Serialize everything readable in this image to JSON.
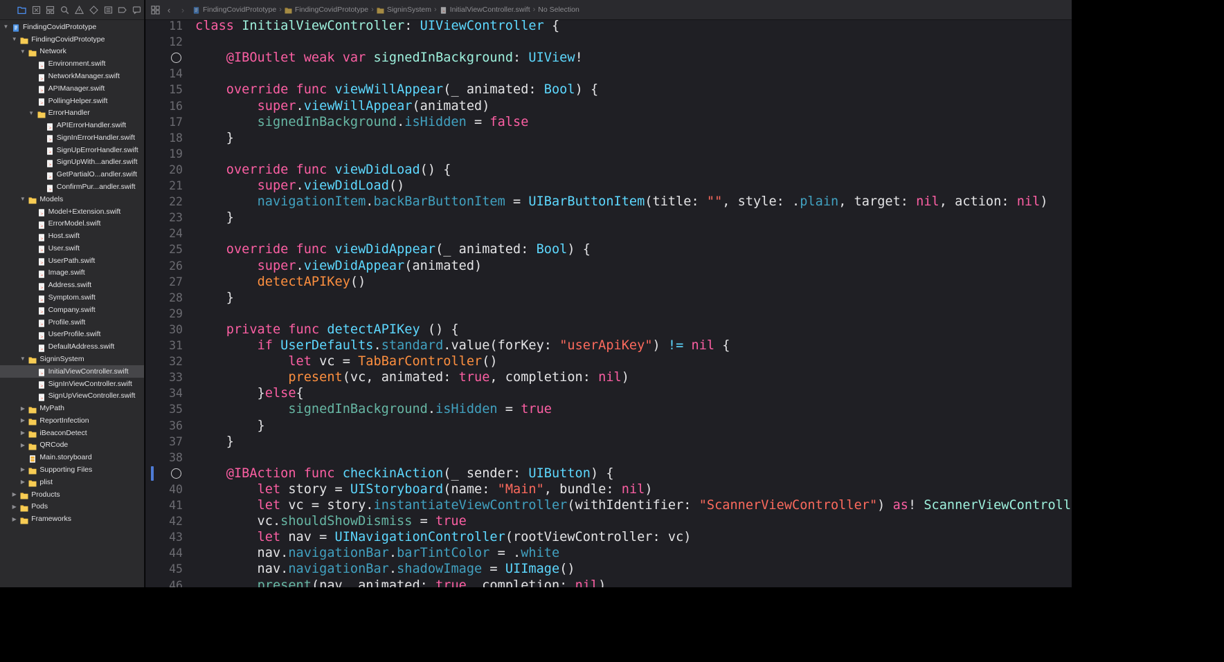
{
  "navigator": {
    "toolbar_icons": [
      "folder-icon",
      "source-control-icon",
      "symbol-icon",
      "find-icon",
      "issue-icon",
      "test-icon",
      "debug-icon",
      "breakpoint-icon",
      "report-icon"
    ],
    "items": [
      {
        "label": "FindingCovidPrototype",
        "depth": 0,
        "kind": "project",
        "disclosure": "open"
      },
      {
        "label": "FindingCovidPrototype",
        "depth": 1,
        "kind": "folder",
        "disclosure": "open"
      },
      {
        "label": "Network",
        "depth": 2,
        "kind": "folder",
        "disclosure": "open"
      },
      {
        "label": "Environment.swift",
        "depth": 3,
        "kind": "swift"
      },
      {
        "label": "NetworkManager.swift",
        "depth": 3,
        "kind": "swift"
      },
      {
        "label": "APIManager.swift",
        "depth": 3,
        "kind": "swift"
      },
      {
        "label": "PollingHelper.swift",
        "depth": 3,
        "kind": "swift"
      },
      {
        "label": "ErrorHandler",
        "depth": 3,
        "kind": "folder",
        "disclosure": "open"
      },
      {
        "label": "APIErrorHandler.swift",
        "depth": 4,
        "kind": "swift"
      },
      {
        "label": "SignInErrorHandler.swift",
        "depth": 4,
        "kind": "swift"
      },
      {
        "label": "SignUpErrorHandler.swift",
        "depth": 4,
        "kind": "swift"
      },
      {
        "label": "SignUpWith...andler.swift",
        "depth": 4,
        "kind": "swift"
      },
      {
        "label": "GetPartialO...andler.swift",
        "depth": 4,
        "kind": "swift"
      },
      {
        "label": "ConfirmPur...andler.swift",
        "depth": 4,
        "kind": "swift"
      },
      {
        "label": "Models",
        "depth": 2,
        "kind": "folder",
        "disclosure": "open"
      },
      {
        "label": "Model+Extension.swift",
        "depth": 3,
        "kind": "swift"
      },
      {
        "label": "ErrorModel.swift",
        "depth": 3,
        "kind": "swift"
      },
      {
        "label": "Host.swift",
        "depth": 3,
        "kind": "swift"
      },
      {
        "label": "User.swift",
        "depth": 3,
        "kind": "swift"
      },
      {
        "label": "UserPath.swift",
        "depth": 3,
        "kind": "swift"
      },
      {
        "label": "Image.swift",
        "depth": 3,
        "kind": "swift"
      },
      {
        "label": "Address.swift",
        "depth": 3,
        "kind": "swift"
      },
      {
        "label": "Symptom.swift",
        "depth": 3,
        "kind": "swift"
      },
      {
        "label": "Company.swift",
        "depth": 3,
        "kind": "swift"
      },
      {
        "label": "Profile.swift",
        "depth": 3,
        "kind": "swift"
      },
      {
        "label": "UserProfile.swift",
        "depth": 3,
        "kind": "swift"
      },
      {
        "label": "DefaultAddress.swift",
        "depth": 3,
        "kind": "swift"
      },
      {
        "label": "SigninSystem",
        "depth": 2,
        "kind": "folder",
        "disclosure": "open"
      },
      {
        "label": "InitialViewController.swift",
        "depth": 3,
        "kind": "swift",
        "selected": true
      },
      {
        "label": "SignInViewController.swift",
        "depth": 3,
        "kind": "swift"
      },
      {
        "label": "SignUpViewController.swift",
        "depth": 3,
        "kind": "swift"
      },
      {
        "label": "MyPath",
        "depth": 2,
        "kind": "folder",
        "disclosure": "closed"
      },
      {
        "label": "ReportInfection",
        "depth": 2,
        "kind": "folder",
        "disclosure": "closed"
      },
      {
        "label": "iBeaconDetect",
        "depth": 2,
        "kind": "folder",
        "disclosure": "closed"
      },
      {
        "label": "QRCode",
        "depth": 2,
        "kind": "folder",
        "disclosure": "closed"
      },
      {
        "label": "Main.storyboard",
        "depth": 2,
        "kind": "storyboard"
      },
      {
        "label": "Supporting Files",
        "depth": 2,
        "kind": "folder",
        "disclosure": "closed"
      },
      {
        "label": "plist",
        "depth": 2,
        "kind": "folder",
        "disclosure": "closed"
      },
      {
        "label": "Products",
        "depth": 1,
        "kind": "folder",
        "disclosure": "closed"
      },
      {
        "label": "Pods",
        "depth": 1,
        "kind": "folder",
        "disclosure": "closed"
      },
      {
        "label": "Frameworks",
        "depth": 1,
        "kind": "folder",
        "disclosure": "closed"
      }
    ]
  },
  "jumpbar": {
    "crumbs": [
      {
        "label": "FindingCovidPrototype",
        "icon": "project-icon"
      },
      {
        "label": "FindingCovidPrototype",
        "icon": "folder-icon"
      },
      {
        "label": "SigninSystem",
        "icon": "folder-icon"
      },
      {
        "label": "InitialViewController.swift",
        "icon": "swift-file-icon"
      },
      {
        "label": "No Selection",
        "icon": ""
      }
    ]
  },
  "editor": {
    "lines": [
      {
        "n": "11",
        "tokens": [
          [
            "kw",
            "class"
          ],
          [
            "pl",
            " "
          ],
          [
            "typ2",
            "InitialViewController"
          ],
          [
            "pl",
            ": "
          ],
          [
            "typ",
            "UIViewController"
          ],
          [
            "pl",
            " {"
          ]
        ]
      },
      {
        "n": "12",
        "tokens": []
      },
      {
        "n": "13",
        "marker": "outlet-connection",
        "tokens": [
          [
            "pl",
            "    "
          ],
          [
            "kw",
            "@IBOutlet"
          ],
          [
            "pl",
            " "
          ],
          [
            "kw",
            "weak"
          ],
          [
            "pl",
            " "
          ],
          [
            "kw",
            "var"
          ],
          [
            "pl",
            " "
          ],
          [
            "typ2",
            "signedInBackground"
          ],
          [
            "pl",
            ": "
          ],
          [
            "typ",
            "UIView"
          ],
          [
            "pl",
            "!"
          ]
        ]
      },
      {
        "n": "14",
        "tokens": []
      },
      {
        "n": "15",
        "tokens": [
          [
            "pl",
            "    "
          ],
          [
            "kw",
            "override"
          ],
          [
            "pl",
            " "
          ],
          [
            "kw",
            "func"
          ],
          [
            "pl",
            " "
          ],
          [
            "typ",
            "viewWillAppear"
          ],
          [
            "pl",
            "(_ animated: "
          ],
          [
            "typ",
            "Bool"
          ],
          [
            "pl",
            ") {"
          ]
        ]
      },
      {
        "n": "16",
        "tokens": [
          [
            "pl",
            "        "
          ],
          [
            "kw",
            "super"
          ],
          [
            "pl",
            "."
          ],
          [
            "typ",
            "viewWillAppear"
          ],
          [
            "pl",
            "(animated)"
          ]
        ]
      },
      {
        "n": "17",
        "tokens": [
          [
            "pl",
            "        "
          ],
          [
            "fn",
            "signedInBackground"
          ],
          [
            "pl",
            "."
          ],
          [
            "mem",
            "isHidden"
          ],
          [
            "pl",
            " = "
          ],
          [
            "kw",
            "false"
          ]
        ]
      },
      {
        "n": "18",
        "tokens": [
          [
            "pl",
            "    }"
          ]
        ]
      },
      {
        "n": "19",
        "tokens": []
      },
      {
        "n": "20",
        "tokens": [
          [
            "pl",
            "    "
          ],
          [
            "kw",
            "override"
          ],
          [
            "pl",
            " "
          ],
          [
            "kw",
            "func"
          ],
          [
            "pl",
            " "
          ],
          [
            "typ",
            "viewDidLoad"
          ],
          [
            "pl",
            "() {"
          ]
        ]
      },
      {
        "n": "21",
        "tokens": [
          [
            "pl",
            "        "
          ],
          [
            "kw",
            "super"
          ],
          [
            "pl",
            "."
          ],
          [
            "typ",
            "viewDidLoad"
          ],
          [
            "pl",
            "()"
          ]
        ]
      },
      {
        "n": "22",
        "tokens": [
          [
            "pl",
            "        "
          ],
          [
            "mem",
            "navigationItem"
          ],
          [
            "pl",
            "."
          ],
          [
            "mem",
            "backBarButtonItem"
          ],
          [
            "pl",
            " = "
          ],
          [
            "typ",
            "UIBarButtonItem"
          ],
          [
            "pl",
            "(title: "
          ],
          [
            "str",
            "\"\""
          ],
          [
            "pl",
            ", style: ."
          ],
          [
            "mem",
            "plain"
          ],
          [
            "pl",
            ", target: "
          ],
          [
            "kw",
            "nil"
          ],
          [
            "pl",
            ", action: "
          ],
          [
            "kw",
            "nil"
          ],
          [
            "pl",
            ")"
          ]
        ]
      },
      {
        "n": "23",
        "tokens": [
          [
            "pl",
            "    }"
          ]
        ]
      },
      {
        "n": "24",
        "tokens": []
      },
      {
        "n": "25",
        "tokens": [
          [
            "pl",
            "    "
          ],
          [
            "kw",
            "override"
          ],
          [
            "pl",
            " "
          ],
          [
            "kw",
            "func"
          ],
          [
            "pl",
            " "
          ],
          [
            "typ",
            "viewDidAppear"
          ],
          [
            "pl",
            "(_ animated: "
          ],
          [
            "typ",
            "Bool"
          ],
          [
            "pl",
            ") {"
          ]
        ]
      },
      {
        "n": "26",
        "tokens": [
          [
            "pl",
            "        "
          ],
          [
            "kw",
            "super"
          ],
          [
            "pl",
            "."
          ],
          [
            "typ",
            "viewDidAppear"
          ],
          [
            "pl",
            "(animated)"
          ]
        ]
      },
      {
        "n": "27",
        "tokens": [
          [
            "pl",
            "        "
          ],
          [
            "org",
            "detectAPIKey"
          ],
          [
            "pl",
            "()"
          ]
        ]
      },
      {
        "n": "28",
        "tokens": [
          [
            "pl",
            "    }"
          ]
        ]
      },
      {
        "n": "29",
        "tokens": []
      },
      {
        "n": "30",
        "tokens": [
          [
            "pl",
            "    "
          ],
          [
            "kw",
            "private"
          ],
          [
            "pl",
            " "
          ],
          [
            "kw",
            "func"
          ],
          [
            "pl",
            " "
          ],
          [
            "typ",
            "detectAPIKey"
          ],
          [
            "pl",
            " () {"
          ]
        ]
      },
      {
        "n": "31",
        "tokens": [
          [
            "pl",
            "        "
          ],
          [
            "kw",
            "if"
          ],
          [
            "pl",
            " "
          ],
          [
            "typ",
            "UserDefaults"
          ],
          [
            "pl",
            "."
          ],
          [
            "mem",
            "standard"
          ],
          [
            "pl",
            ".value(forKey: "
          ],
          [
            "str",
            "\"userApiKey\""
          ],
          [
            "pl",
            ") "
          ],
          [
            "typ",
            "!="
          ],
          [
            "pl",
            " "
          ],
          [
            "kw",
            "nil"
          ],
          [
            "pl",
            " {"
          ]
        ]
      },
      {
        "n": "32",
        "tokens": [
          [
            "pl",
            "            "
          ],
          [
            "kw",
            "let"
          ],
          [
            "pl",
            " vc = "
          ],
          [
            "org",
            "TabBarController"
          ],
          [
            "pl",
            "()"
          ]
        ]
      },
      {
        "n": "33",
        "tokens": [
          [
            "pl",
            "            "
          ],
          [
            "org",
            "present"
          ],
          [
            "pl",
            "(vc, animated: "
          ],
          [
            "kw",
            "true"
          ],
          [
            "pl",
            ", completion: "
          ],
          [
            "kw",
            "nil"
          ],
          [
            "pl",
            ")"
          ]
        ]
      },
      {
        "n": "34",
        "tokens": [
          [
            "pl",
            "        }"
          ],
          [
            "kw",
            "else"
          ],
          [
            "pl",
            "{"
          ]
        ]
      },
      {
        "n": "35",
        "tokens": [
          [
            "pl",
            "            "
          ],
          [
            "fn",
            "signedInBackground"
          ],
          [
            "pl",
            "."
          ],
          [
            "mem",
            "isHidden"
          ],
          [
            "pl",
            " = "
          ],
          [
            "kw",
            "true"
          ]
        ]
      },
      {
        "n": "36",
        "tokens": [
          [
            "pl",
            "        }"
          ]
        ]
      },
      {
        "n": "37",
        "tokens": [
          [
            "pl",
            "    }"
          ]
        ]
      },
      {
        "n": "38",
        "tokens": []
      },
      {
        "n": "39",
        "marker": "action-connection",
        "changed": true,
        "tokens": [
          [
            "pl",
            "    "
          ],
          [
            "kw",
            "@IBAction"
          ],
          [
            "pl",
            " "
          ],
          [
            "kw",
            "func"
          ],
          [
            "pl",
            " "
          ],
          [
            "typ",
            "checkinAction"
          ],
          [
            "pl",
            "(_ sender: "
          ],
          [
            "typ",
            "UIButton"
          ],
          [
            "pl",
            ") {"
          ]
        ]
      },
      {
        "n": "40",
        "tokens": [
          [
            "pl",
            "        "
          ],
          [
            "kw",
            "let"
          ],
          [
            "pl",
            " story = "
          ],
          [
            "typ",
            "UIStoryboard"
          ],
          [
            "pl",
            "(name: "
          ],
          [
            "str",
            "\"Main\""
          ],
          [
            "pl",
            ", bundle: "
          ],
          [
            "kw",
            "nil"
          ],
          [
            "pl",
            ")"
          ]
        ]
      },
      {
        "n": "41",
        "tokens": [
          [
            "pl",
            "        "
          ],
          [
            "kw",
            "let"
          ],
          [
            "pl",
            " vc = story."
          ],
          [
            "mem",
            "instantiateViewController"
          ],
          [
            "pl",
            "(withIdentifier: "
          ],
          [
            "str",
            "\"ScannerViewController\""
          ],
          [
            "pl",
            ") "
          ],
          [
            "kw",
            "as"
          ],
          [
            "pl",
            "! "
          ],
          [
            "typ2",
            "ScannerViewController"
          ]
        ]
      },
      {
        "n": "42",
        "tokens": [
          [
            "pl",
            "        vc."
          ],
          [
            "fn",
            "shouldShowDismiss"
          ],
          [
            "pl",
            " = "
          ],
          [
            "kw",
            "true"
          ]
        ]
      },
      {
        "n": "43",
        "tokens": [
          [
            "pl",
            "        "
          ],
          [
            "kw",
            "let"
          ],
          [
            "pl",
            " nav = "
          ],
          [
            "typ",
            "UINavigationController"
          ],
          [
            "pl",
            "(rootViewController: vc)"
          ]
        ]
      },
      {
        "n": "44",
        "tokens": [
          [
            "pl",
            "        nav."
          ],
          [
            "mem",
            "navigationBar"
          ],
          [
            "pl",
            "."
          ],
          [
            "mem",
            "barTintColor"
          ],
          [
            "pl",
            " = ."
          ],
          [
            "mem",
            "white"
          ]
        ]
      },
      {
        "n": "45",
        "tokens": [
          [
            "pl",
            "        nav."
          ],
          [
            "mem",
            "navigationBar"
          ],
          [
            "pl",
            "."
          ],
          [
            "mem",
            "shadowImage"
          ],
          [
            "pl",
            " = "
          ],
          [
            "typ",
            "UIImage"
          ],
          [
            "pl",
            "()"
          ]
        ]
      },
      {
        "n": "46",
        "tokens": [
          [
            "pl",
            "        "
          ],
          [
            "fn",
            "present"
          ],
          [
            "pl",
            "(nav, animated: "
          ],
          [
            "kw",
            "true"
          ],
          [
            "pl",
            ", completion: "
          ],
          [
            "kw",
            "nil"
          ],
          [
            "pl",
            ")"
          ]
        ]
      }
    ]
  },
  "colors": {
    "keyword": "#fc5fa3",
    "type": "#5dd8ff",
    "string": "#fc6a5d",
    "member": "#41a1c0",
    "editor_bg": "#1f1f24",
    "navigator_bg": "#2b2b2d",
    "folder": "#f5c242",
    "selection": "#464649"
  }
}
